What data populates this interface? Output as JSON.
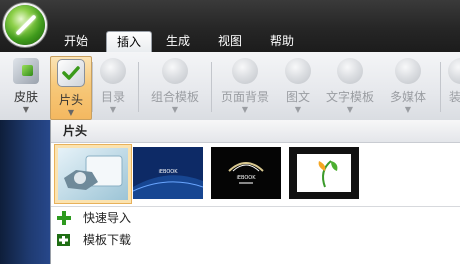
{
  "menubar": {
    "tabs": [
      {
        "label": "开始",
        "active": false
      },
      {
        "label": "插入",
        "active": true
      },
      {
        "label": "生成",
        "active": false
      },
      {
        "label": "视图",
        "active": false
      },
      {
        "label": "帮助",
        "active": false
      }
    ]
  },
  "ribbon": {
    "buttons": [
      {
        "label": "皮肤",
        "icon": "skin-icon",
        "state": "normal"
      },
      {
        "label": "片头",
        "icon": "intro-check-icon",
        "state": "pressed"
      },
      {
        "label": "目录",
        "icon": "toc-icon",
        "state": "disabled"
      },
      {
        "label": "组合模板",
        "icon": "combo-template-icon",
        "state": "disabled"
      },
      {
        "label": "页面背景",
        "icon": "page-background-icon",
        "state": "disabled"
      },
      {
        "label": "图文",
        "icon": "image-text-icon",
        "state": "disabled"
      },
      {
        "label": "文字模板",
        "icon": "text-template-icon",
        "state": "disabled"
      },
      {
        "label": "多媒体",
        "icon": "multimedia-icon",
        "state": "disabled"
      },
      {
        "label": "装",
        "icon": "decor-icon",
        "state": "disabled"
      }
    ]
  },
  "dropdown": {
    "header": "片头",
    "thumbnails": [
      {
        "name": "intro-thumbnail-1",
        "selected": true
      },
      {
        "name": "intro-thumbnail-2",
        "selected": false,
        "logo_text": "iEBOOK"
      },
      {
        "name": "intro-thumbnail-3",
        "selected": false,
        "logo_text": "iEBOOK"
      },
      {
        "name": "intro-thumbnail-4",
        "selected": false
      }
    ],
    "items": [
      {
        "label": "快速导入",
        "icon": "green-plus-icon"
      },
      {
        "label": "模板下载",
        "icon": "download-plus-icon"
      }
    ]
  },
  "colors": {
    "accent_pressed": "#f7c97a",
    "selection": "#fbe3b0",
    "menubar": "#262626"
  }
}
